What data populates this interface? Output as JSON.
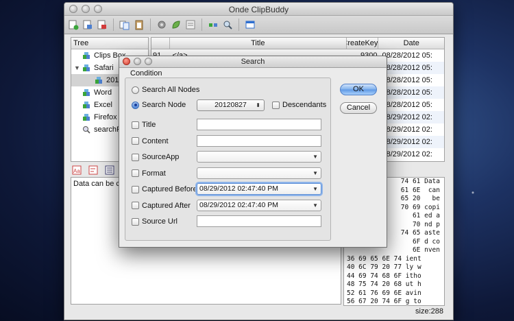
{
  "window": {
    "title": "Onde ClipBuddy"
  },
  "tree": {
    "header": "Tree",
    "items": [
      {
        "label": "Clips Box",
        "indent": 16,
        "icon": "clipbox-icon"
      },
      {
        "label": "Safari",
        "indent": 16,
        "icon": "app-node-icon",
        "expanded": true
      },
      {
        "label": "20120827",
        "indent": 34,
        "icon": "date-node-icon",
        "selected": true
      },
      {
        "label": "Word",
        "indent": 16,
        "icon": "app-node-icon"
      },
      {
        "label": "Excel",
        "indent": 16,
        "icon": "app-node-icon"
      },
      {
        "label": "Firefox",
        "indent": 16,
        "icon": "app-node-icon"
      },
      {
        "label": "searchResult",
        "indent": 16,
        "icon": "search-node-icon"
      }
    ]
  },
  "grid": {
    "columns": [
      "",
      "Title",
      "CreateKey",
      "Date"
    ],
    "rows": [
      {
        "num": "91",
        "title": "</a>",
        "key": "9300",
        "date": "08/28/2012 05:"
      },
      {
        "num": "",
        "title": "",
        "key": "",
        "date": "08/28/2012 05:"
      },
      {
        "num": "",
        "title": "",
        "key": "",
        "date": "08/28/2012 05:"
      },
      {
        "num": "",
        "title": "",
        "key": "",
        "date": "08/28/2012 05:"
      },
      {
        "num": "",
        "title": "",
        "key": "",
        "date": "08/28/2012 05:"
      },
      {
        "num": "",
        "title": "",
        "key": "",
        "date": "08/29/2012 02:"
      },
      {
        "num": "",
        "title": "",
        "key": "",
        "date": "08/29/2012 02:"
      },
      {
        "num": "",
        "title": "",
        "key": "",
        "date": "08/29/2012 02:"
      },
      {
        "num": "",
        "title": "",
        "key": "",
        "date": "08/29/2012 02:"
      }
    ]
  },
  "note": {
    "text": "Data can be copied between apps."
  },
  "hex": {
    "rows": [
      "74 61 Data",
      "61 6E  can",
      "65 20   be",
      "70 69 copi",
      "61 ed a",
      "70 nd p",
      "74 65 aste",
      "6F d co",
      "6E nven",
      "36 69 65 6E 74 ient",
      "40 6C 79 20 77 ly w",
      "44 69 74 68 6F itho",
      "48 75 74 20 68 ut h",
      "52 61 76 69 6E avin",
      "56 67 20 74 6F g to",
      "60 20 63 6F 6E con"
    ]
  },
  "status": {
    "size": "size:288"
  },
  "dialog": {
    "title": "Search",
    "group": "Condition",
    "search_all": "Search All Nodes",
    "search_node": "Search Node",
    "node_value": "20120827",
    "descendants": "Descendants",
    "ok": "OK",
    "cancel": "Cancel",
    "fields": [
      {
        "label": "Title",
        "kind": "text",
        "value": ""
      },
      {
        "label": "Content",
        "kind": "text",
        "value": ""
      },
      {
        "label": "SourceApp",
        "kind": "combo",
        "value": ""
      },
      {
        "label": "Format",
        "kind": "combo",
        "value": ""
      },
      {
        "label": "Captured Before",
        "kind": "combo",
        "value": "08/29/2012 02:47:40 PM",
        "focus": true
      },
      {
        "label": "Captured After",
        "kind": "combo",
        "value": "08/29/2012 02:47:40 PM"
      },
      {
        "label": "Source Url",
        "kind": "text",
        "value": ""
      }
    ]
  },
  "colors": {
    "accent": "#5e98e5",
    "selection": "#d3d3d3"
  }
}
